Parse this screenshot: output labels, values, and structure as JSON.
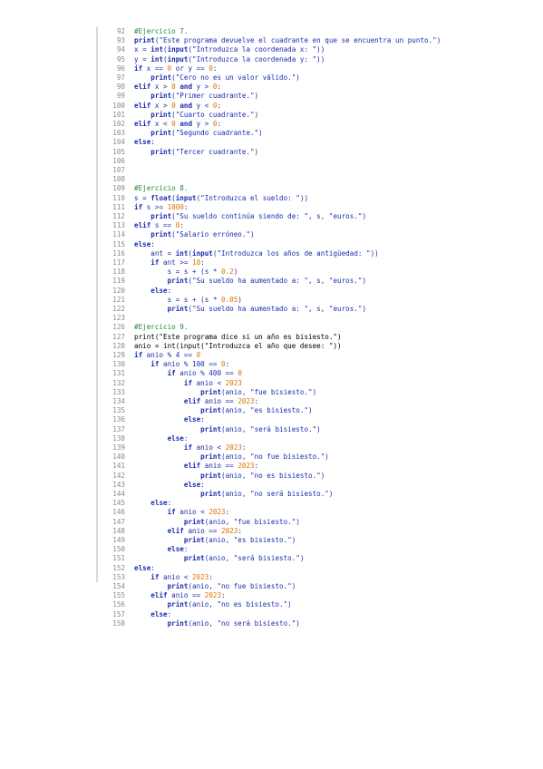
{
  "code_lines": [
    {
      "n": "92",
      "tokens": [
        {
          "t": "#Ejercicio 7.",
          "c": "comment"
        }
      ]
    },
    {
      "n": "93",
      "tokens": [
        {
          "t": "print",
          "c": "kw"
        },
        {
          "t": "(\"Este programa devuelve el cuadrante en que se encuentra un punto.\")",
          "c": "str"
        }
      ]
    },
    {
      "n": "94",
      "tokens": [
        {
          "t": "x = ",
          "c": "str"
        },
        {
          "t": "int",
          "c": "kw"
        },
        {
          "t": "(",
          "c": "str"
        },
        {
          "t": "input",
          "c": "kw"
        },
        {
          "t": "(\"Introduzca la coordenada x: \"))",
          "c": "str"
        }
      ]
    },
    {
      "n": "95",
      "tokens": [
        {
          "t": "y = ",
          "c": "str"
        },
        {
          "t": "int",
          "c": "kw"
        },
        {
          "t": "(",
          "c": "str"
        },
        {
          "t": "input",
          "c": "kw"
        },
        {
          "t": "(\"Introduzca la coordenada y: \"))",
          "c": "str"
        }
      ]
    },
    {
      "n": "96",
      "tokens": [
        {
          "t": "if",
          "c": "kw"
        },
        {
          "t": " x == ",
          "c": "str"
        },
        {
          "t": "0",
          "c": "num"
        },
        {
          "t": " or y == ",
          "c": "str"
        },
        {
          "t": "0",
          "c": "num"
        },
        {
          "t": ":",
          "c": "str"
        }
      ]
    },
    {
      "n": "97",
      "tokens": [
        {
          "t": "    ",
          "c": "text"
        },
        {
          "t": "print",
          "c": "kw"
        },
        {
          "t": "(\"Cero no es un valor válido.\")",
          "c": "str"
        }
      ]
    },
    {
      "n": "98",
      "tokens": [
        {
          "t": "elif",
          "c": "kw"
        },
        {
          "t": " x > ",
          "c": "str"
        },
        {
          "t": "0",
          "c": "num"
        },
        {
          "t": " ",
          "c": "str"
        },
        {
          "t": "and",
          "c": "kw"
        },
        {
          "t": " y > ",
          "c": "str"
        },
        {
          "t": "0",
          "c": "num"
        },
        {
          "t": ":",
          "c": "str"
        }
      ]
    },
    {
      "n": "99",
      "tokens": [
        {
          "t": "    ",
          "c": "text"
        },
        {
          "t": "print",
          "c": "kw"
        },
        {
          "t": "(\"Primer cuadrante.\")",
          "c": "str"
        }
      ]
    },
    {
      "n": "100",
      "tokens": [
        {
          "t": "elif",
          "c": "kw"
        },
        {
          "t": " x > ",
          "c": "str"
        },
        {
          "t": "0",
          "c": "num"
        },
        {
          "t": " ",
          "c": "str"
        },
        {
          "t": "and",
          "c": "kw"
        },
        {
          "t": " y < ",
          "c": "str"
        },
        {
          "t": "0",
          "c": "num"
        },
        {
          "t": ":",
          "c": "str"
        }
      ]
    },
    {
      "n": "101",
      "tokens": [
        {
          "t": "    ",
          "c": "text"
        },
        {
          "t": "print",
          "c": "kw"
        },
        {
          "t": "(\"Cuarto cuadrante.\")",
          "c": "str"
        }
      ]
    },
    {
      "n": "102",
      "tokens": [
        {
          "t": "elif",
          "c": "kw"
        },
        {
          "t": " x < ",
          "c": "str"
        },
        {
          "t": "0",
          "c": "num"
        },
        {
          "t": " ",
          "c": "str"
        },
        {
          "t": "and",
          "c": "kw"
        },
        {
          "t": " y > ",
          "c": "str"
        },
        {
          "t": "0",
          "c": "num"
        },
        {
          "t": ":",
          "c": "str"
        }
      ]
    },
    {
      "n": "103",
      "tokens": [
        {
          "t": "    ",
          "c": "text"
        },
        {
          "t": "print",
          "c": "kw"
        },
        {
          "t": "(\"Segundo cuadrante.\")",
          "c": "str"
        }
      ]
    },
    {
      "n": "104",
      "tokens": [
        {
          "t": "else",
          "c": "kw"
        },
        {
          "t": ":",
          "c": "str"
        }
      ]
    },
    {
      "n": "105",
      "tokens": [
        {
          "t": "    ",
          "c": "text"
        },
        {
          "t": "print",
          "c": "kw"
        },
        {
          "t": "(\"Tercer cuadrante.\")",
          "c": "str"
        }
      ]
    },
    {
      "n": "106",
      "tokens": []
    },
    {
      "n": "107",
      "tokens": []
    },
    {
      "n": "108",
      "tokens": []
    },
    {
      "n": "109",
      "tokens": [
        {
          "t": "#Ejercicio 8.",
          "c": "comment"
        }
      ]
    },
    {
      "n": "110",
      "tokens": [
        {
          "t": "s = ",
          "c": "str"
        },
        {
          "t": "float",
          "c": "kw"
        },
        {
          "t": "(",
          "c": "str"
        },
        {
          "t": "input",
          "c": "kw"
        },
        {
          "t": "(\"Introduzca el sueldo: \"))",
          "c": "str"
        }
      ]
    },
    {
      "n": "111",
      "tokens": [
        {
          "t": "if",
          "c": "kw"
        },
        {
          "t": " s >= ",
          "c": "str"
        },
        {
          "t": "1000",
          "c": "num"
        },
        {
          "t": ":",
          "c": "str"
        }
      ]
    },
    {
      "n": "112",
      "tokens": [
        {
          "t": "    ",
          "c": "text"
        },
        {
          "t": "print",
          "c": "kw"
        },
        {
          "t": "(\"Su sueldo continúa siendo de: \", s, \"euros.\")",
          "c": "str"
        }
      ]
    },
    {
      "n": "113",
      "tokens": [
        {
          "t": "elif",
          "c": "kw"
        },
        {
          "t": " s == ",
          "c": "str"
        },
        {
          "t": "0",
          "c": "num"
        },
        {
          "t": ":",
          "c": "str"
        }
      ]
    },
    {
      "n": "114",
      "tokens": [
        {
          "t": "    ",
          "c": "text"
        },
        {
          "t": "print",
          "c": "kw"
        },
        {
          "t": "(\"Salario erróneo.\")",
          "c": "str"
        }
      ]
    },
    {
      "n": "115",
      "tokens": [
        {
          "t": "else",
          "c": "kw"
        },
        {
          "t": ":",
          "c": "str"
        }
      ]
    },
    {
      "n": "116",
      "tokens": [
        {
          "t": "    ant = ",
          "c": "str"
        },
        {
          "t": "int",
          "c": "kw"
        },
        {
          "t": "(",
          "c": "str"
        },
        {
          "t": "input",
          "c": "kw"
        },
        {
          "t": "(\"Introduzca los años de antigüedad: \"))",
          "c": "str"
        }
      ]
    },
    {
      "n": "117",
      "tokens": [
        {
          "t": "    ",
          "c": "text"
        },
        {
          "t": "if",
          "c": "kw"
        },
        {
          "t": " ant >= ",
          "c": "str"
        },
        {
          "t": "10",
          "c": "num"
        },
        {
          "t": ":",
          "c": "str"
        }
      ]
    },
    {
      "n": "118",
      "tokens": [
        {
          "t": "        s = s + (s * ",
          "c": "str"
        },
        {
          "t": "0.2",
          "c": "num"
        },
        {
          "t": ")",
          "c": "str"
        }
      ]
    },
    {
      "n": "119",
      "tokens": [
        {
          "t": "        ",
          "c": "text"
        },
        {
          "t": "print",
          "c": "kw"
        },
        {
          "t": "(\"Su sueldo ha aumentado a: \", s, \"euros.\")",
          "c": "str"
        }
      ]
    },
    {
      "n": "120",
      "tokens": [
        {
          "t": "    ",
          "c": "text"
        },
        {
          "t": "else",
          "c": "kw"
        },
        {
          "t": ":",
          "c": "str"
        }
      ]
    },
    {
      "n": "121",
      "tokens": [
        {
          "t": "        s = s + (s * ",
          "c": "str"
        },
        {
          "t": "0.05",
          "c": "num"
        },
        {
          "t": ")",
          "c": "str"
        }
      ]
    },
    {
      "n": "122",
      "tokens": [
        {
          "t": "        ",
          "c": "text"
        },
        {
          "t": "print",
          "c": "kw"
        },
        {
          "t": "(\"Su sueldo ha aumentado a: \", s, \"euros.\")",
          "c": "str"
        }
      ]
    },
    {
      "n": "123",
      "tokens": []
    },
    {
      "n": "126",
      "tokens": [
        {
          "t": "#Ejercicio 9.",
          "c": "comment"
        }
      ]
    },
    {
      "n": "127",
      "tokens": [
        {
          "t": "print",
          "c": "text"
        },
        {
          "t": "(\"Este programa dice si un año es bisiesto.\")",
          "c": "text"
        }
      ]
    },
    {
      "n": "128",
      "tokens": [
        {
          "t": "anio = ",
          "c": "text"
        },
        {
          "t": "int",
          "c": "text"
        },
        {
          "t": "(",
          "c": "text"
        },
        {
          "t": "input",
          "c": "text"
        },
        {
          "t": "(\"Introduzca el año que desee: \"))",
          "c": "text"
        }
      ]
    },
    {
      "n": "129",
      "tokens": [
        {
          "t": "if",
          "c": "kw"
        },
        {
          "t": " anio % 4 == ",
          "c": "str"
        },
        {
          "t": "0",
          "c": "num"
        }
      ]
    },
    {
      "n": "130",
      "tokens": [
        {
          "t": "    ",
          "c": "text"
        },
        {
          "t": "if",
          "c": "kw"
        },
        {
          "t": " anio % 100 == ",
          "c": "str"
        },
        {
          "t": "0",
          "c": "num"
        },
        {
          "t": ":",
          "c": "str"
        }
      ]
    },
    {
      "n": "131",
      "tokens": [
        {
          "t": "        ",
          "c": "text"
        },
        {
          "t": "if",
          "c": "kw"
        },
        {
          "t": " anio % 400 == ",
          "c": "str"
        },
        {
          "t": "0",
          "c": "num"
        }
      ]
    },
    {
      "n": "132",
      "tokens": [
        {
          "t": "            ",
          "c": "text"
        },
        {
          "t": "if",
          "c": "kw"
        },
        {
          "t": " anio < ",
          "c": "str"
        },
        {
          "t": "2023",
          "c": "num"
        }
      ]
    },
    {
      "n": "133",
      "tokens": [
        {
          "t": "                ",
          "c": "text"
        },
        {
          "t": "print",
          "c": "kw"
        },
        {
          "t": "(anio, \"fue bisiesto.\")",
          "c": "str"
        }
      ]
    },
    {
      "n": "134",
      "tokens": [
        {
          "t": "            ",
          "c": "text"
        },
        {
          "t": "elif",
          "c": "kw"
        },
        {
          "t": " anio == ",
          "c": "str"
        },
        {
          "t": "2023",
          "c": "num"
        },
        {
          "t": ":",
          "c": "str"
        }
      ]
    },
    {
      "n": "135",
      "tokens": [
        {
          "t": "                ",
          "c": "text"
        },
        {
          "t": "print",
          "c": "kw"
        },
        {
          "t": "(anio, \"es bisiesto.\")",
          "c": "str"
        }
      ]
    },
    {
      "n": "136",
      "tokens": [
        {
          "t": "            ",
          "c": "text"
        },
        {
          "t": "else",
          "c": "kw"
        },
        {
          "t": ":",
          "c": "str"
        }
      ]
    },
    {
      "n": "137",
      "tokens": [
        {
          "t": "                ",
          "c": "text"
        },
        {
          "t": "print",
          "c": "kw"
        },
        {
          "t": "(anio, \"será bisiesto.\")",
          "c": "str"
        }
      ]
    },
    {
      "n": "138",
      "tokens": [
        {
          "t": "        ",
          "c": "text"
        },
        {
          "t": "else",
          "c": "kw"
        },
        {
          "t": ":",
          "c": "str"
        }
      ]
    },
    {
      "n": "139",
      "tokens": [
        {
          "t": "            ",
          "c": "text"
        },
        {
          "t": "if",
          "c": "kw"
        },
        {
          "t": " anio < ",
          "c": "str"
        },
        {
          "t": "2023",
          "c": "num"
        },
        {
          "t": ":",
          "c": "str"
        }
      ]
    },
    {
      "n": "140",
      "tokens": [
        {
          "t": "                ",
          "c": "text"
        },
        {
          "t": "print",
          "c": "kw"
        },
        {
          "t": "(anio, \"no fue bisiesto.\")",
          "c": "str"
        }
      ]
    },
    {
      "n": "141",
      "tokens": [
        {
          "t": "            ",
          "c": "text"
        },
        {
          "t": "elif",
          "c": "kw"
        },
        {
          "t": " anio == ",
          "c": "str"
        },
        {
          "t": "2023",
          "c": "num"
        },
        {
          "t": ":",
          "c": "str"
        }
      ]
    },
    {
      "n": "142",
      "tokens": [
        {
          "t": "                ",
          "c": "text"
        },
        {
          "t": "print",
          "c": "kw"
        },
        {
          "t": "(anio, \"no es bisiesto.\")",
          "c": "str"
        }
      ]
    },
    {
      "n": "143",
      "tokens": [
        {
          "t": "            ",
          "c": "text"
        },
        {
          "t": "else",
          "c": "kw"
        },
        {
          "t": ":",
          "c": "str"
        }
      ]
    },
    {
      "n": "144",
      "tokens": [
        {
          "t": "                ",
          "c": "text"
        },
        {
          "t": "print",
          "c": "kw"
        },
        {
          "t": "(anio, \"no será bisiesto.\")",
          "c": "str"
        }
      ]
    },
    {
      "n": "145",
      "tokens": [
        {
          "t": "    ",
          "c": "text"
        },
        {
          "t": "else",
          "c": "kw"
        },
        {
          "t": ":",
          "c": "str"
        }
      ]
    },
    {
      "n": "146",
      "tokens": [
        {
          "t": "        ",
          "c": "text"
        },
        {
          "t": "if",
          "c": "kw"
        },
        {
          "t": " anio < ",
          "c": "str"
        },
        {
          "t": "2023",
          "c": "num"
        },
        {
          "t": ":",
          "c": "str"
        }
      ]
    },
    {
      "n": "147",
      "tokens": [
        {
          "t": "            ",
          "c": "text"
        },
        {
          "t": "print",
          "c": "kw"
        },
        {
          "t": "(anio, \"fue bisiesto.\")",
          "c": "str"
        }
      ]
    },
    {
      "n": "148",
      "tokens": [
        {
          "t": "        ",
          "c": "text"
        },
        {
          "t": "elif",
          "c": "kw"
        },
        {
          "t": " anio == ",
          "c": "str"
        },
        {
          "t": "2023",
          "c": "num"
        },
        {
          "t": ":",
          "c": "str"
        }
      ]
    },
    {
      "n": "149",
      "tokens": [
        {
          "t": "            ",
          "c": "text"
        },
        {
          "t": "print",
          "c": "kw"
        },
        {
          "t": "(anio, \"es bisiesto.\")",
          "c": "str"
        }
      ]
    },
    {
      "n": "150",
      "tokens": [
        {
          "t": "        ",
          "c": "text"
        },
        {
          "t": "else",
          "c": "kw"
        },
        {
          "t": ":",
          "c": "str"
        }
      ]
    },
    {
      "n": "151",
      "tokens": [
        {
          "t": "            ",
          "c": "text"
        },
        {
          "t": "print",
          "c": "kw"
        },
        {
          "t": "(anio, \"será bisiesto.\")",
          "c": "str"
        }
      ]
    },
    {
      "n": "152",
      "tokens": [
        {
          "t": "else",
          "c": "kw"
        },
        {
          "t": ":",
          "c": "str"
        }
      ]
    },
    {
      "n": "153",
      "tokens": [
        {
          "t": "    ",
          "c": "text"
        },
        {
          "t": "if",
          "c": "kw"
        },
        {
          "t": " anio < ",
          "c": "str"
        },
        {
          "t": "2023",
          "c": "num"
        },
        {
          "t": ":",
          "c": "str"
        }
      ]
    },
    {
      "n": "154",
      "tokens": [
        {
          "t": "        ",
          "c": "text"
        },
        {
          "t": "print",
          "c": "kw"
        },
        {
          "t": "(anio, \"no fue bisiesto.\")",
          "c": "str"
        }
      ]
    },
    {
      "n": "155",
      "tokens": [
        {
          "t": "    ",
          "c": "text"
        },
        {
          "t": "elif",
          "c": "kw"
        },
        {
          "t": " anio == ",
          "c": "str"
        },
        {
          "t": "2023",
          "c": "num"
        },
        {
          "t": ":",
          "c": "str"
        }
      ]
    },
    {
      "n": "156",
      "tokens": [
        {
          "t": "        ",
          "c": "text"
        },
        {
          "t": "print",
          "c": "kw"
        },
        {
          "t": "(anio, \"no es bisiesto.\")",
          "c": "str"
        }
      ]
    },
    {
      "n": "157",
      "tokens": [
        {
          "t": "    ",
          "c": "text"
        },
        {
          "t": "else",
          "c": "kw"
        },
        {
          "t": ":",
          "c": "str"
        }
      ]
    },
    {
      "n": "158",
      "tokens": [
        {
          "t": "        ",
          "c": "text"
        },
        {
          "t": "print",
          "c": "kw"
        },
        {
          "t": "(anio, \"no será bisiesto.\")",
          "c": "str"
        }
      ]
    }
  ],
  "colors": {
    "keyword": "#1b2dae",
    "string": "#1b2dae",
    "number": "#e07000",
    "comment": "#238a3a",
    "line_number": "#8a8a8a",
    "gutter_border": "#d9d9d9",
    "background": "#ffffff"
  }
}
